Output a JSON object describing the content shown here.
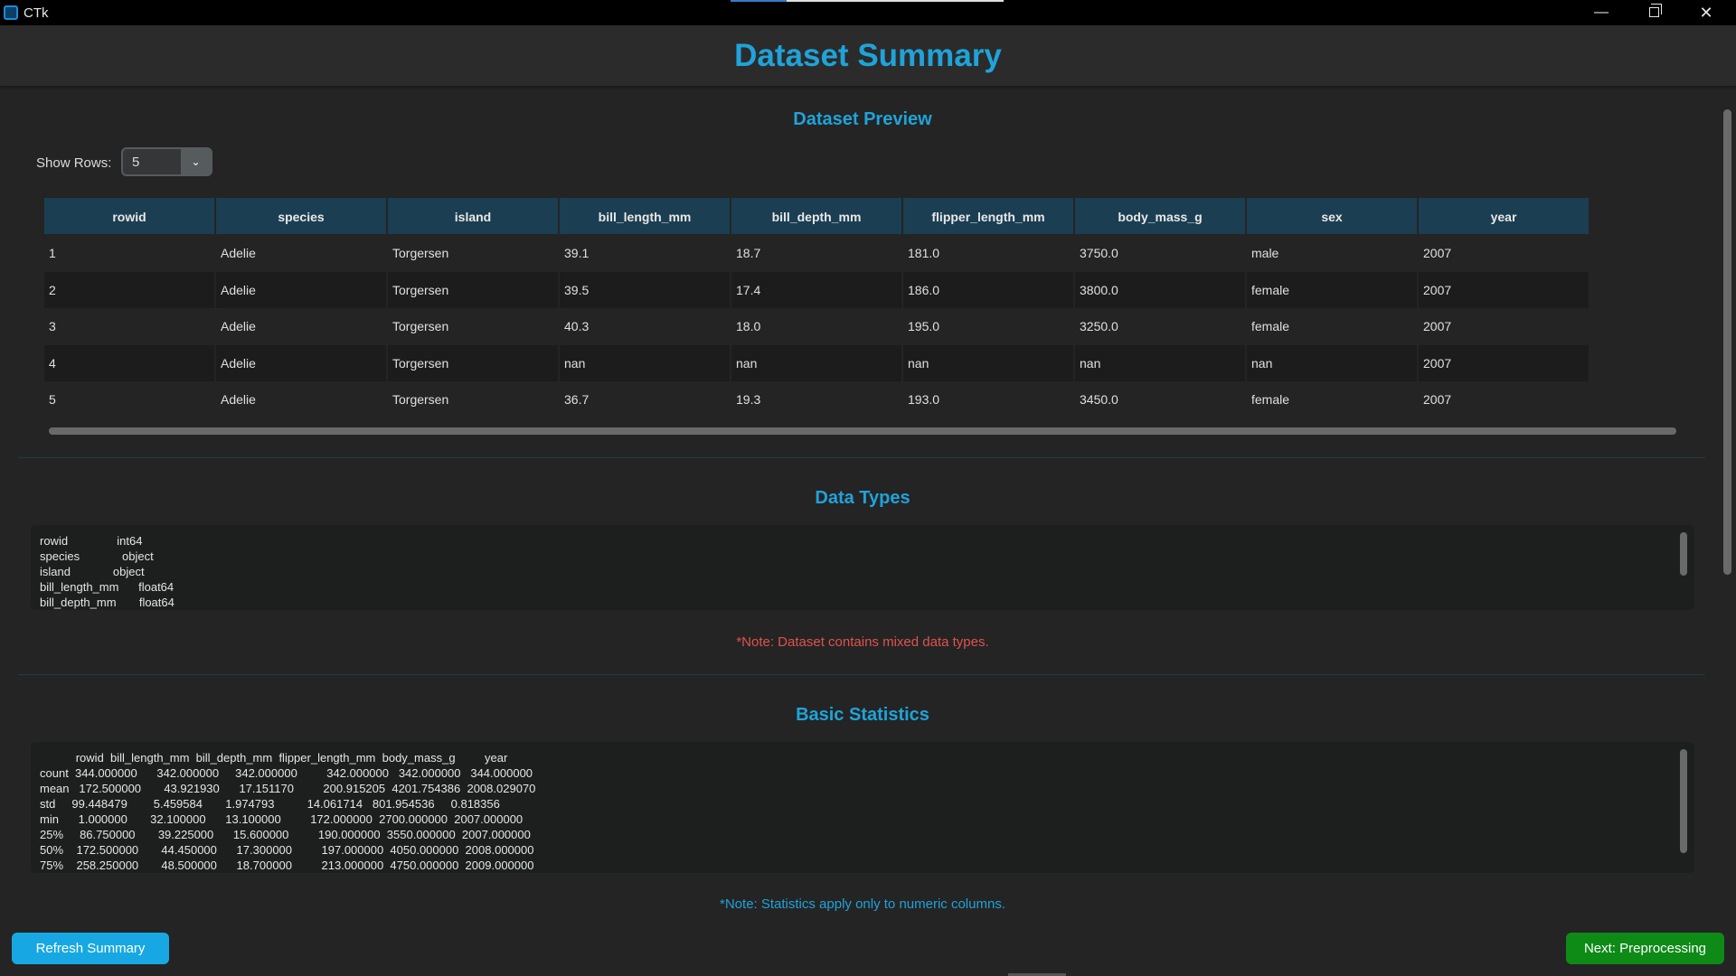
{
  "window": {
    "title": "CTk",
    "minimize": "—",
    "close": "✕"
  },
  "header": {
    "title": "Dataset Summary"
  },
  "preview": {
    "title": "Dataset Preview",
    "show_rows_label": "Show Rows:",
    "show_rows_value": "5",
    "columns": [
      "rowid",
      "species",
      "island",
      "bill_length_mm",
      "bill_depth_mm",
      "flipper_length_mm",
      "body_mass_g",
      "sex",
      "year"
    ],
    "rows": [
      [
        "1",
        "Adelie",
        "Torgersen",
        "39.1",
        "18.7",
        "181.0",
        "3750.0",
        "male",
        "2007"
      ],
      [
        "2",
        "Adelie",
        "Torgersen",
        "39.5",
        "17.4",
        "186.0",
        "3800.0",
        "female",
        "2007"
      ],
      [
        "3",
        "Adelie",
        "Torgersen",
        "40.3",
        "18.0",
        "195.0",
        "3250.0",
        "female",
        "2007"
      ],
      [
        "4",
        "Adelie",
        "Torgersen",
        "nan",
        "nan",
        "nan",
        "nan",
        "nan",
        "2007"
      ],
      [
        "5",
        "Adelie",
        "Torgersen",
        "36.7",
        "19.3",
        "193.0",
        "3450.0",
        "female",
        "2007"
      ]
    ]
  },
  "dtypes": {
    "title": "Data Types",
    "text": "rowid               int64\nspecies             object\nisland             object\nbill_length_mm      float64\nbill_depth_mm       float64",
    "note": "*Note: Dataset contains mixed data types."
  },
  "stats": {
    "title": "Basic Statistics",
    "text": "           rowid  bill_length_mm  bill_depth_mm  flipper_length_mm  body_mass_g         year\ncount  344.000000      342.000000     342.000000         342.000000   342.000000   344.000000\nmean   172.500000       43.921930      17.151170         200.915205  4201.754386  2008.029070\nstd     99.448479        5.459584       1.974793          14.061714   801.954536     0.818356\nmin      1.000000       32.100000      13.100000         172.000000  2700.000000  2007.000000\n25%     86.750000       39.225000      15.600000         190.000000  3550.000000  2007.000000\n50%    172.500000       44.450000      17.300000         197.000000  4050.000000  2008.000000\n75%    258.250000       48.500000      18.700000         213.000000  4750.000000  2009.000000",
    "note": "*Note: Statistics apply only to numeric columns."
  },
  "buttons": {
    "refresh": "Refresh Summary",
    "next": "Next: Preprocessing"
  },
  "colors": {
    "accent": "#1fa3d9",
    "header_bg": "#1b3e52",
    "note_red": "#e0524c",
    "next_green": "#0e8a17"
  }
}
